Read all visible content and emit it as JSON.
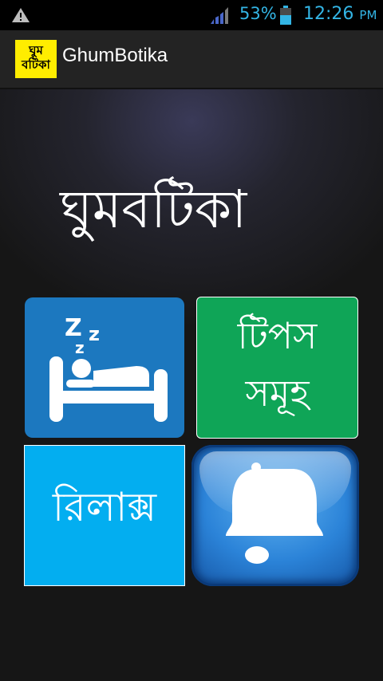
{
  "status_bar": {
    "battery_percent": "53%",
    "time": "12:26",
    "ampm": "PM",
    "icons": [
      "warning-icon",
      "signal-icon",
      "battery-icon"
    ],
    "accent_color": "#33b5e5"
  },
  "action_bar": {
    "app_icon_line1": "ঘুম",
    "app_icon_line2": "বটিকা",
    "title": "GhumBotika"
  },
  "main": {
    "hero_title": "ঘুমবটিকা",
    "tiles": [
      {
        "name": "sleep",
        "icon": "sleep-bed-icon",
        "zzz": [
          "Z",
          "z",
          "z"
        ],
        "color": "#1c78bf"
      },
      {
        "name": "tips",
        "line1": "টিপস",
        "line2": "সমূহ",
        "color": "#0fa557"
      },
      {
        "name": "relax",
        "label": "রিলাক্স",
        "color": "#03aef0"
      },
      {
        "name": "alarm",
        "icon": "bell-icon",
        "color": "#2b83d8"
      }
    ]
  }
}
